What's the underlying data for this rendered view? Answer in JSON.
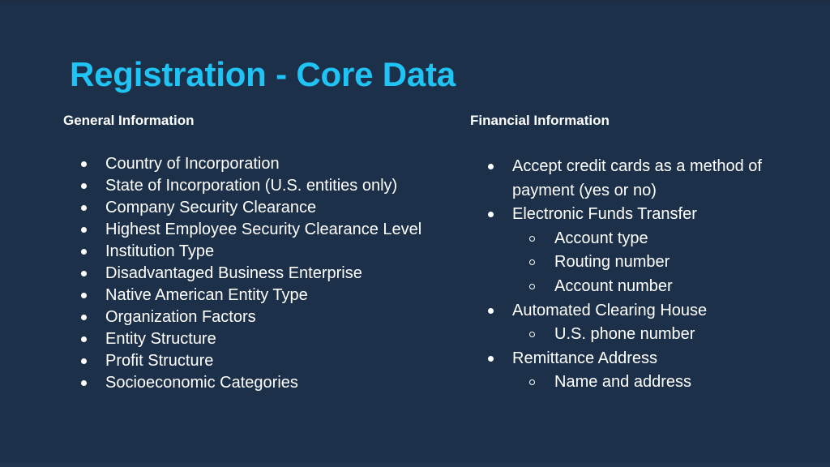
{
  "slide": {
    "title": "Registration - Core Data",
    "background_color": "#1d3049",
    "title_color": "#20c4f4",
    "text_color": "#ffffff"
  },
  "columns": [
    {
      "id": "general",
      "heading": "General Information",
      "items": [
        {
          "text": "Country of Incorporation",
          "level": 1
        },
        {
          "text": "State of Incorporation (U.S. entities only)",
          "level": 1
        },
        {
          "text": "Company Security Clearance",
          "level": 1
        },
        {
          "text": "Highest Employee Security Clearance Level",
          "level": 1
        },
        {
          "text": "Institution Type",
          "level": 1
        },
        {
          "text": "Disadvantaged Business Enterprise",
          "level": 1
        },
        {
          "text": "Native American Entity Type",
          "level": 1
        },
        {
          "text": "Organization Factors",
          "level": 1
        },
        {
          "text": "Entity Structure",
          "level": 1
        },
        {
          "text": "Profit Structure",
          "level": 1
        },
        {
          "text": "Socioeconomic Categories",
          "level": 1
        }
      ]
    },
    {
      "id": "financial",
      "heading": "Financial Information",
      "items": [
        {
          "text": "Accept credit cards as a method of payment (yes or no)",
          "level": 1,
          "sub": []
        },
        {
          "text": "Electronic Funds Transfer",
          "level": 1,
          "sub": [
            {
              "text": "Account type",
              "level": 2
            },
            {
              "text": "Routing number",
              "level": 2
            },
            {
              "text": "Account number",
              "level": 2
            }
          ]
        },
        {
          "text": "Automated Clearing House",
          "level": 1,
          "sub": [
            {
              "text": "U.S. phone number",
              "level": 2
            }
          ]
        },
        {
          "text": "Remittance Address",
          "level": 1,
          "sub": [
            {
              "text": "Name and address",
              "level": 2
            }
          ]
        }
      ]
    }
  ]
}
